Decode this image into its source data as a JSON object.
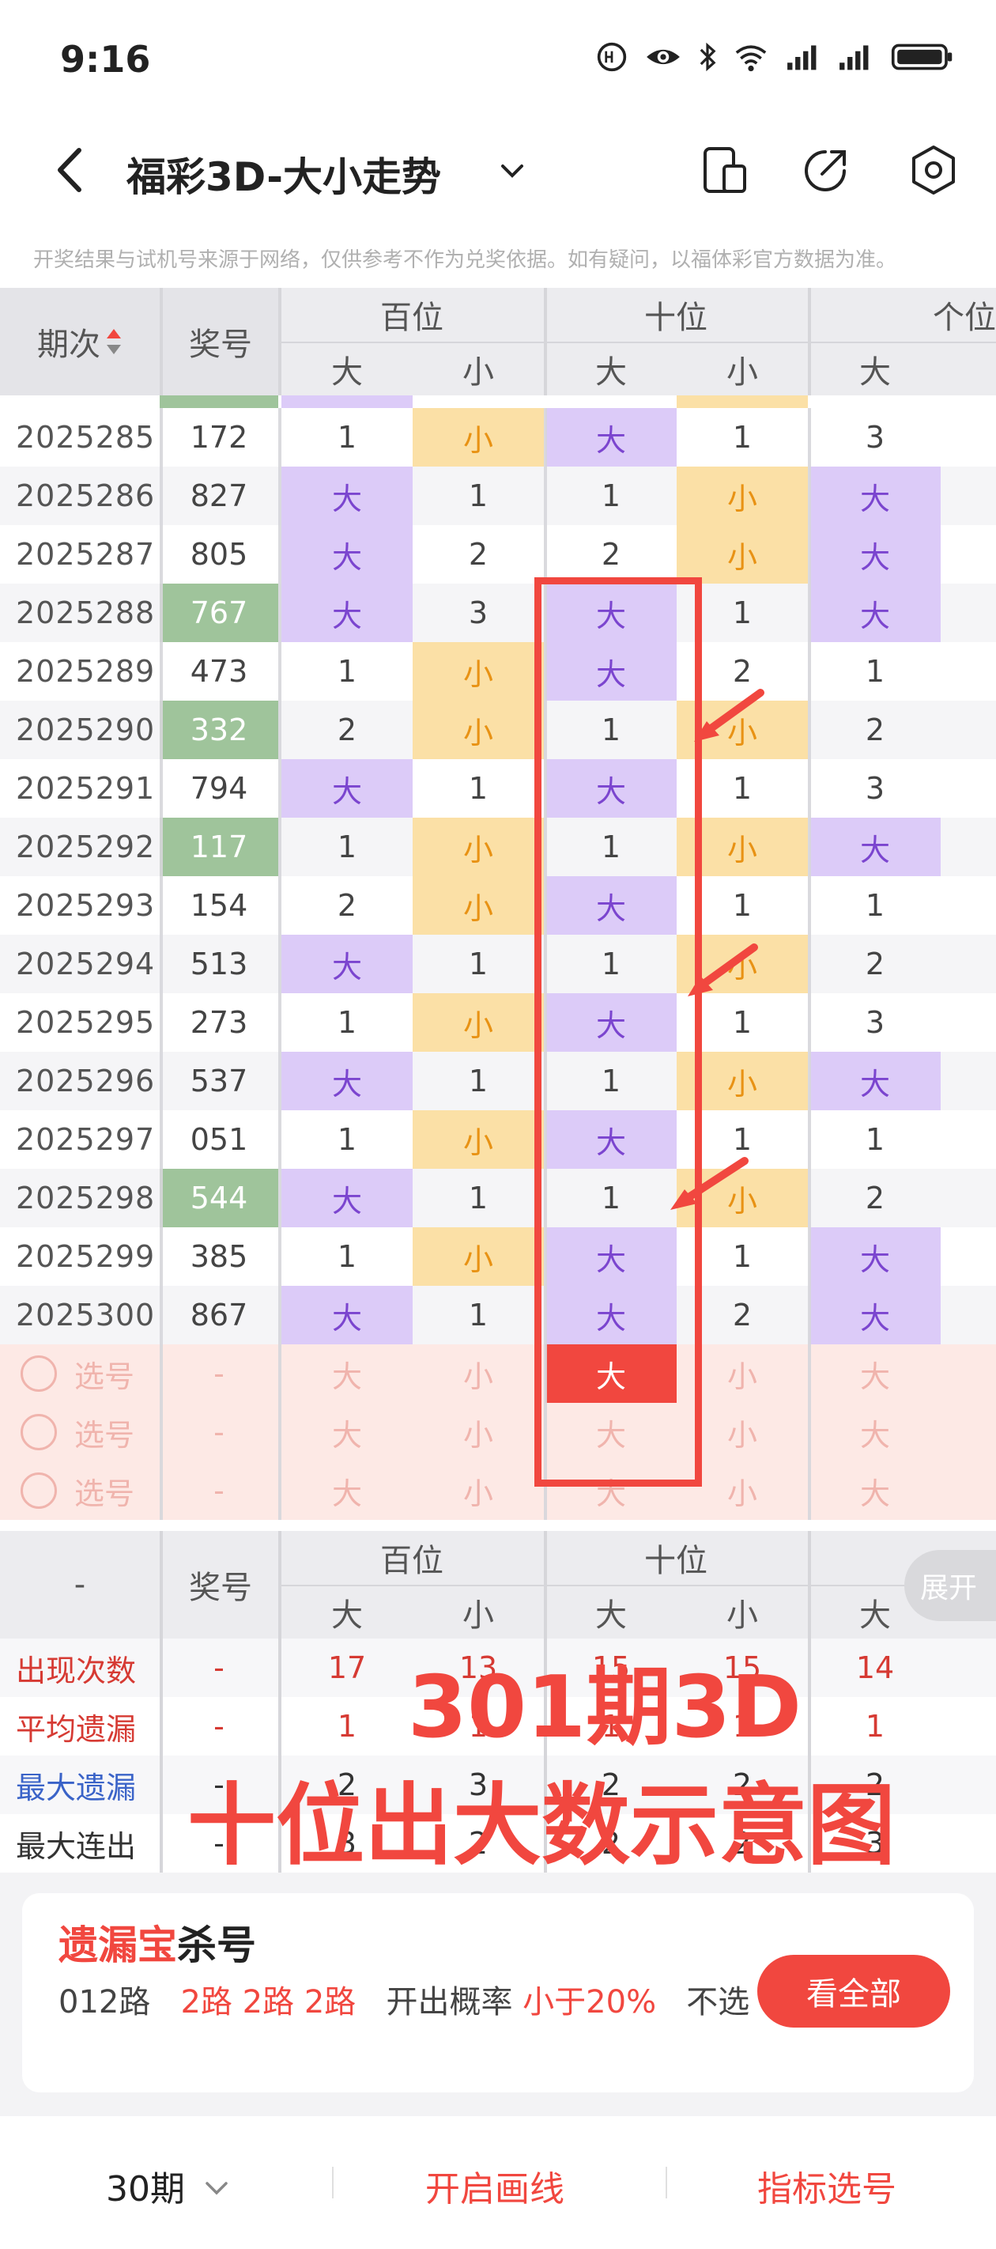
{
  "status_bar": {
    "time": "9:16"
  },
  "header": {
    "title": "福彩3D-大小走势"
  },
  "notice": "开奖结果与试机号来源于网络，仅供参考不作为兑奖依据。如有疑问，以福体彩官方数据为准。",
  "table": {
    "col_issue": "期次",
    "col_number": "奖号",
    "group_hundreds": "百位",
    "group_tens": "十位",
    "group_units": "个位",
    "big": "大",
    "small": "小",
    "rows": [
      {
        "issue": "2025285",
        "number": "172",
        "green": false,
        "h": [
          "1",
          "小"
        ],
        "t": [
          "大",
          "1"
        ],
        "u": [
          "3",
          ""
        ]
      },
      {
        "issue": "2025286",
        "number": "827",
        "green": false,
        "h": [
          "大",
          "1"
        ],
        "t": [
          "1",
          "小"
        ],
        "u": [
          "大",
          ""
        ]
      },
      {
        "issue": "2025287",
        "number": "805",
        "green": false,
        "h": [
          "大",
          "2"
        ],
        "t": [
          "2",
          "小"
        ],
        "u": [
          "大",
          ""
        ]
      },
      {
        "issue": "2025288",
        "number": "767",
        "green": true,
        "h": [
          "大",
          "3"
        ],
        "t": [
          "大",
          "1"
        ],
        "u": [
          "大",
          ""
        ]
      },
      {
        "issue": "2025289",
        "number": "473",
        "green": false,
        "h": [
          "1",
          "小"
        ],
        "t": [
          "大",
          "2"
        ],
        "u": [
          "1",
          ""
        ]
      },
      {
        "issue": "2025290",
        "number": "332",
        "green": true,
        "h": [
          "2",
          "小"
        ],
        "t": [
          "1",
          "小"
        ],
        "u": [
          "2",
          ""
        ]
      },
      {
        "issue": "2025291",
        "number": "794",
        "green": false,
        "h": [
          "大",
          "1"
        ],
        "t": [
          "大",
          "1"
        ],
        "u": [
          "3",
          ""
        ]
      },
      {
        "issue": "2025292",
        "number": "117",
        "green": true,
        "h": [
          "1",
          "小"
        ],
        "t": [
          "1",
          "小"
        ],
        "u": [
          "大",
          ""
        ]
      },
      {
        "issue": "2025293",
        "number": "154",
        "green": false,
        "h": [
          "2",
          "小"
        ],
        "t": [
          "大",
          "1"
        ],
        "u": [
          "1",
          ""
        ]
      },
      {
        "issue": "2025294",
        "number": "513",
        "green": false,
        "h": [
          "大",
          "1"
        ],
        "t": [
          "1",
          "小"
        ],
        "u": [
          "2",
          ""
        ]
      },
      {
        "issue": "2025295",
        "number": "273",
        "green": false,
        "h": [
          "1",
          "小"
        ],
        "t": [
          "大",
          "1"
        ],
        "u": [
          "3",
          ""
        ]
      },
      {
        "issue": "2025296",
        "number": "537",
        "green": false,
        "h": [
          "大",
          "1"
        ],
        "t": [
          "1",
          "小"
        ],
        "u": [
          "大",
          ""
        ]
      },
      {
        "issue": "2025297",
        "number": "051",
        "green": false,
        "h": [
          "1",
          "小"
        ],
        "t": [
          "大",
          "1"
        ],
        "u": [
          "1",
          ""
        ]
      },
      {
        "issue": "2025298",
        "number": "544",
        "green": true,
        "h": [
          "大",
          "1"
        ],
        "t": [
          "1",
          "小"
        ],
        "u": [
          "2",
          ""
        ]
      },
      {
        "issue": "2025299",
        "number": "385",
        "green": false,
        "h": [
          "1",
          "小"
        ],
        "t": [
          "大",
          "1"
        ],
        "u": [
          "大",
          ""
        ]
      },
      {
        "issue": "2025300",
        "number": "867",
        "green": false,
        "h": [
          "大",
          "1"
        ],
        "t": [
          "大",
          "2"
        ],
        "u": [
          "大",
          ""
        ]
      }
    ],
    "pick_label": "选号",
    "pick_dash": "-"
  },
  "stats": {
    "dash": "-",
    "col_number": "奖号",
    "expand": "展开",
    "rows": [
      {
        "label": "出现次数",
        "color": "#d63a33",
        "num": "-",
        "h_big": "17",
        "h_small": "13",
        "t_big": "15",
        "t_small": "15",
        "u_big": "14"
      },
      {
        "label": "平均遗漏",
        "color": "#d63a33",
        "num": "-",
        "h_big": "1",
        "h_small": "1",
        "t_big": "1",
        "t_small": "1",
        "u_big": "1"
      },
      {
        "label": "最大遗漏",
        "color": "#3a63c8",
        "num": "-",
        "h_big": "2",
        "h_small": "3",
        "t_big": "2",
        "t_small": "2",
        "u_big": "2"
      },
      {
        "label": "最大连出",
        "color": "#333333",
        "num": "-",
        "h_big": "3",
        "h_small": "2",
        "t_big": "2",
        "t_small": "2",
        "u_big": "3"
      }
    ]
  },
  "annotation": {
    "line1": "301期3D",
    "line2": "十位出大数示意图"
  },
  "promo": {
    "title_red": "遗漏宝",
    "title_dark": "杀号",
    "route": "012路",
    "routes_red": "2路 2路 2路",
    "prob_label": "开出概率",
    "prob_value": "小于20%",
    "tail": "不选",
    "button": "看全部"
  },
  "bottom": {
    "periods": "30期",
    "draw_line": "开启画线",
    "indicator": "指标选号"
  },
  "colors": {
    "accent": "#f1473f",
    "big_bg": "#dccbf8",
    "small_bg": "#fbe0a6",
    "repeat_bg": "#9fc49b"
  }
}
